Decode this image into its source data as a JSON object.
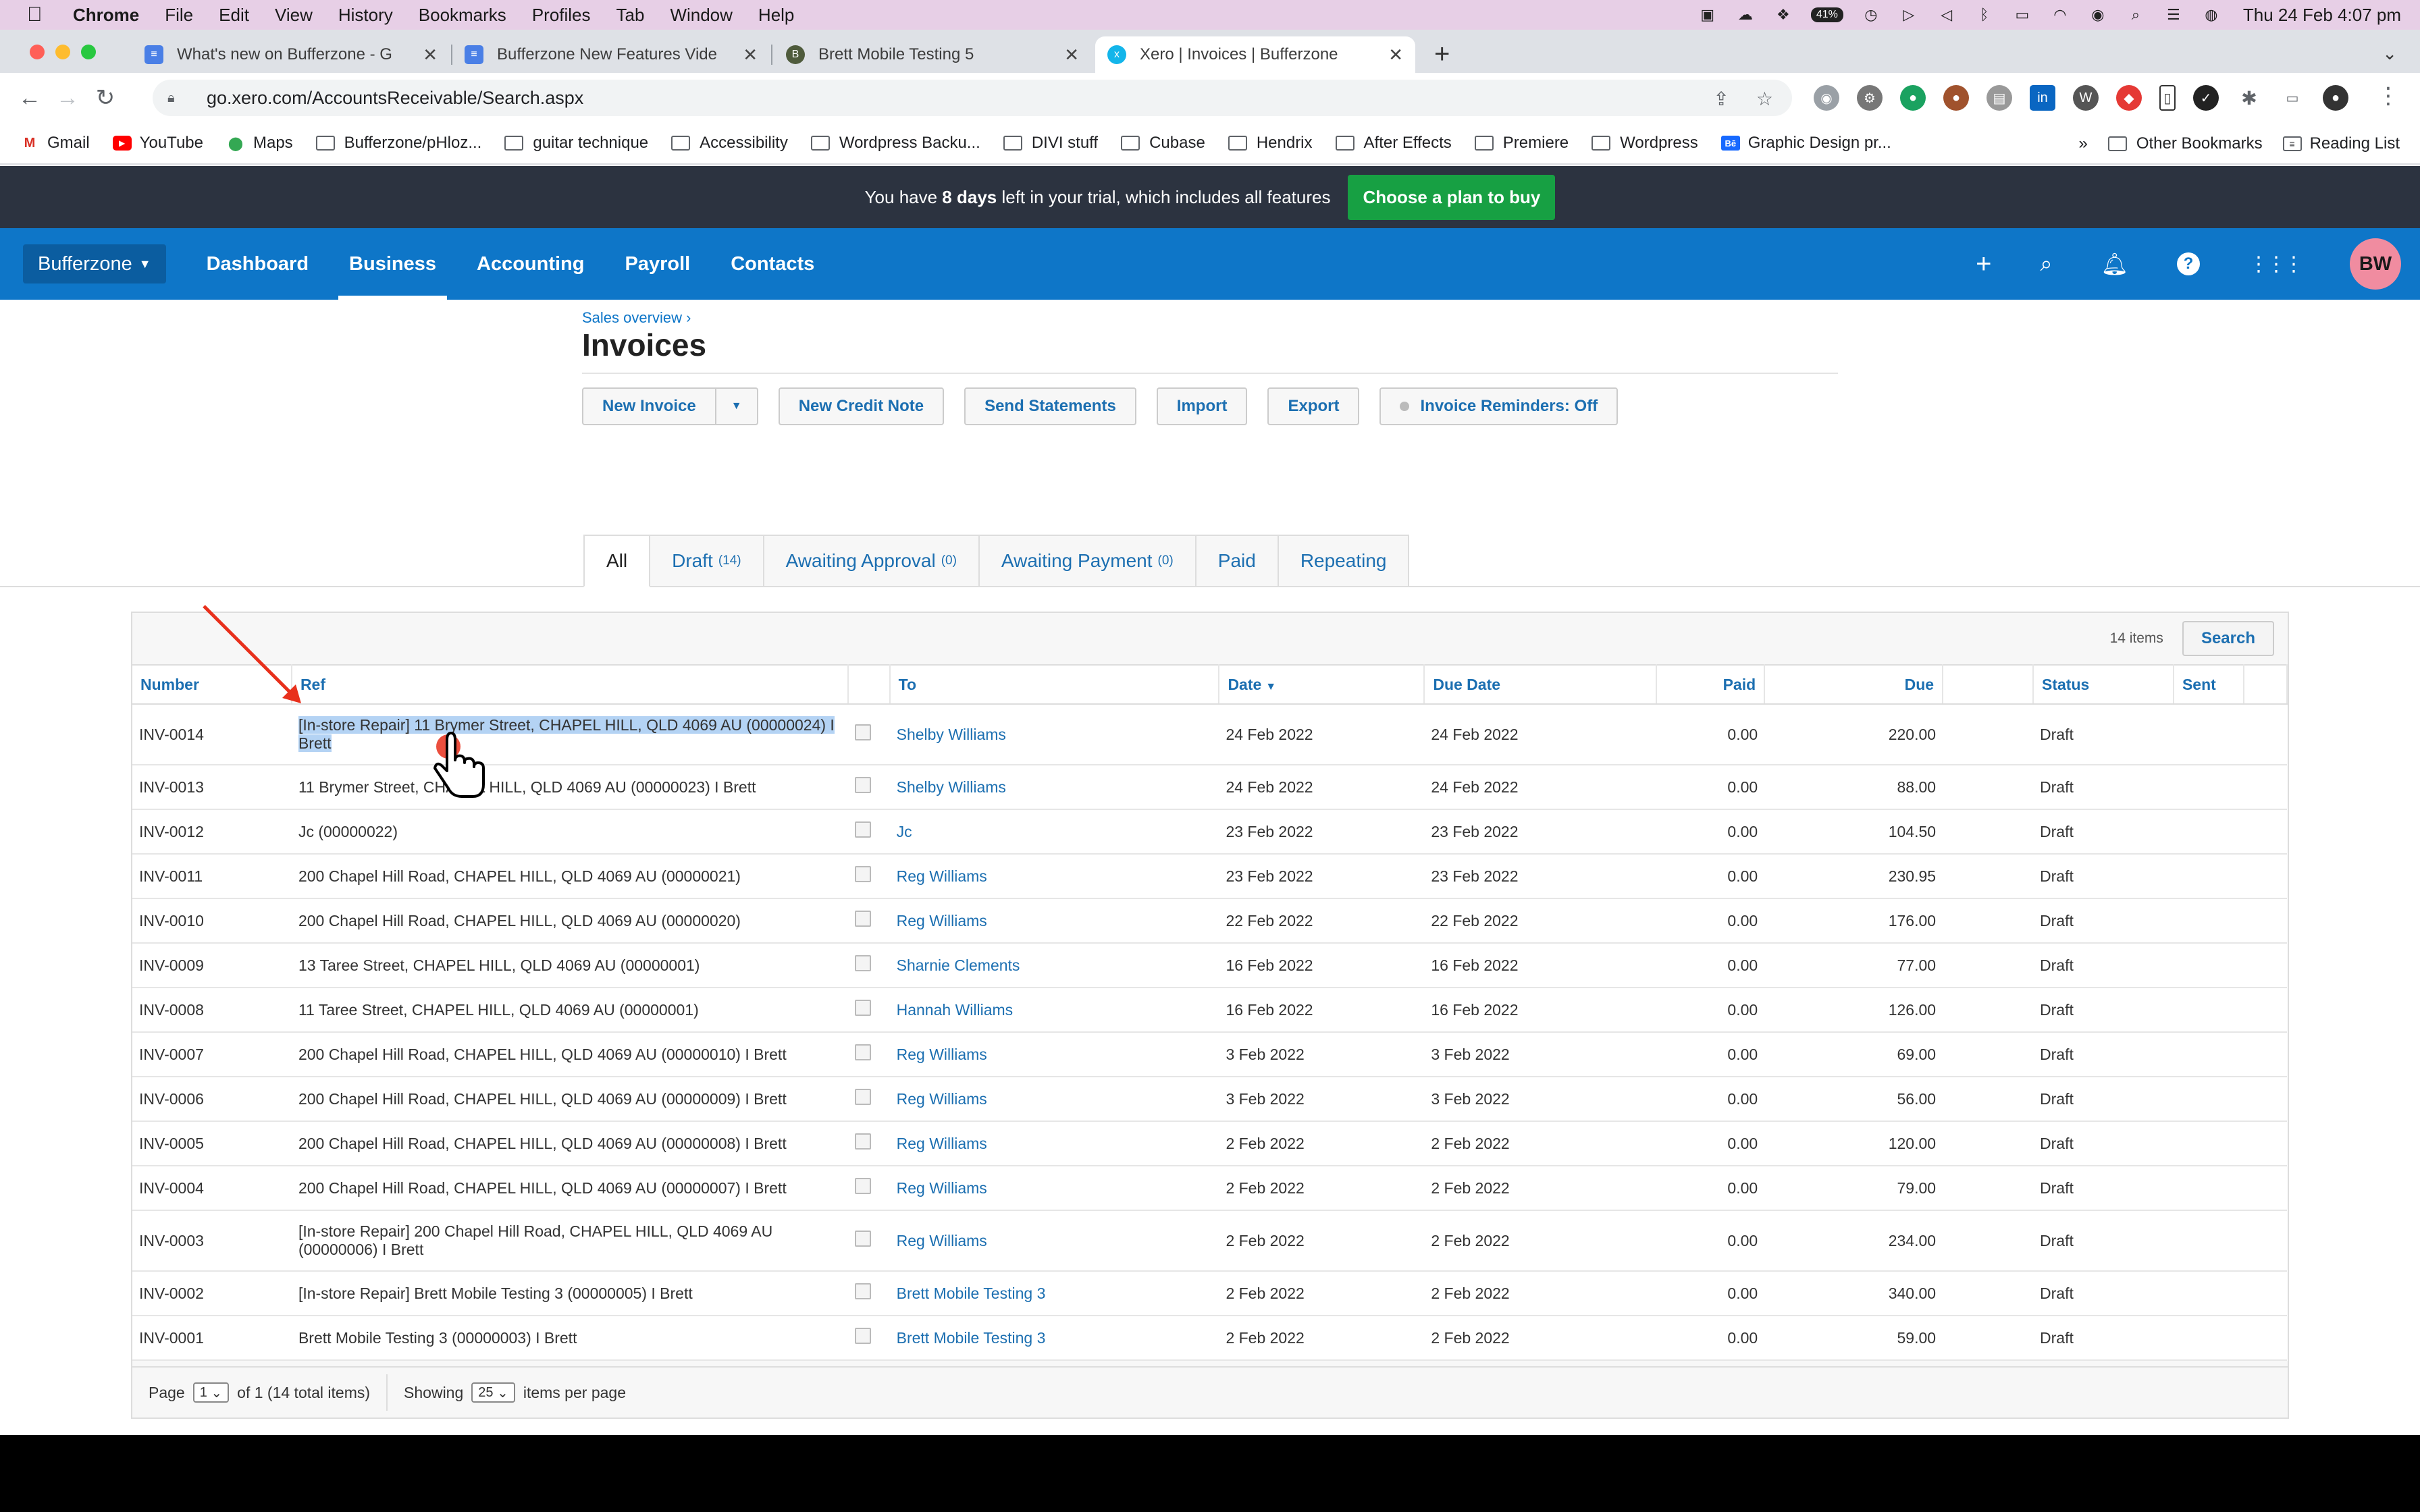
{
  "menubar": {
    "items": [
      "Chrome",
      "File",
      "Edit",
      "View",
      "History",
      "Bookmarks",
      "Profiles",
      "Tab",
      "Window",
      "Help"
    ],
    "battery_text": "41%",
    "clock": "Thu 24 Feb  4:07 pm"
  },
  "tabs": [
    {
      "title": "What's new on Bufferzone - G",
      "favicon_color": "#4a7fe6",
      "favicon": "doc-icon"
    },
    {
      "title": "Bufferzone New Features Vide",
      "favicon_color": "#4a7fe6",
      "favicon": "doc-icon"
    },
    {
      "title": "Brett Mobile Testing 5",
      "favicon_color": "#4f5b3c",
      "favicon": "b-icon"
    },
    {
      "title": "Xero | Invoices | Bufferzone",
      "favicon_color": "#13b5ea",
      "favicon": "xero-icon"
    }
  ],
  "omnibox": {
    "url": "go.xero.com/AccountsReceivable/Search.aspx"
  },
  "bookmarks": [
    {
      "label": "Gmail",
      "type": "gmail"
    },
    {
      "label": "YouTube",
      "type": "youtube"
    },
    {
      "label": "Maps",
      "type": "maps"
    },
    {
      "label": "Bufferzone/pHloz...",
      "type": "folder"
    },
    {
      "label": "guitar technique",
      "type": "folder"
    },
    {
      "label": "Accessibility",
      "type": "folder"
    },
    {
      "label": "Wordpress Backu...",
      "type": "folder"
    },
    {
      "label": "DIVI stuff",
      "type": "folder"
    },
    {
      "label": "Cubase",
      "type": "folder"
    },
    {
      "label": "Hendrix",
      "type": "folder"
    },
    {
      "label": "After Effects",
      "type": "folder"
    },
    {
      "label": "Premiere",
      "type": "folder"
    },
    {
      "label": "Wordpress",
      "type": "folder"
    },
    {
      "label": "Graphic Design pr...",
      "type": "behance"
    }
  ],
  "bookmarks_more": "»",
  "bookmarks_other": "Other Bookmarks",
  "bookmarks_reading": "Reading List",
  "trial": {
    "prefix": "You have ",
    "days": "8 days",
    "suffix": " left in your trial, which includes all features",
    "button": "Choose a plan to buy"
  },
  "xero_nav": {
    "org": "Bufferzone",
    "items": [
      "Dashboard",
      "Business",
      "Accounting",
      "Payroll",
      "Contacts"
    ],
    "active": "Business",
    "avatar": "BW"
  },
  "page": {
    "breadcrumb": "Sales overview ›",
    "title": "Invoices"
  },
  "actions": {
    "new_invoice": "New Invoice",
    "new_credit_note": "New Credit Note",
    "send_statements": "Send Statements",
    "import": "Import",
    "export": "Export",
    "reminders": "Invoice Reminders: Off"
  },
  "filter_tabs": [
    {
      "label": "All",
      "count": ""
    },
    {
      "label": "Draft",
      "count": "(14)"
    },
    {
      "label": "Awaiting Approval",
      "count": "(0)"
    },
    {
      "label": "Awaiting Payment",
      "count": "(0)"
    },
    {
      "label": "Paid",
      "count": ""
    },
    {
      "label": "Repeating",
      "count": ""
    }
  ],
  "grid": {
    "items_count": "14 items",
    "search_label": "Search",
    "columns": {
      "number": "Number",
      "ref": "Ref",
      "to": "To",
      "date": "Date",
      "due_date": "Due Date",
      "paid": "Paid",
      "due": "Due",
      "status": "Status",
      "sent": "Sent"
    },
    "rows": [
      {
        "number": "INV-0014",
        "ref": "[In-store Repair] 11 Brymer Street, CHAPEL HILL, QLD 4069 AU (00000024) I Brett",
        "to": "Shelby Williams",
        "date": "24 Feb 2022",
        "due_date": "24 Feb 2022",
        "paid": "0.00",
        "due": "220.00",
        "status": "Draft"
      },
      {
        "number": "INV-0013",
        "ref": "11 Brymer Street, CHAPEL HILL, QLD 4069 AU (00000023) I Brett",
        "to": "Shelby Williams",
        "date": "24 Feb 2022",
        "due_date": "24 Feb 2022",
        "paid": "0.00",
        "due": "88.00",
        "status": "Draft"
      },
      {
        "number": "INV-0012",
        "ref": "Jc (00000022)",
        "to": "Jc",
        "date": "23 Feb 2022",
        "due_date": "23 Feb 2022",
        "paid": "0.00",
        "due": "104.50",
        "status": "Draft"
      },
      {
        "number": "INV-0011",
        "ref": "200 Chapel Hill Road, CHAPEL HILL, QLD 4069 AU (00000021)",
        "to": "Reg Williams",
        "date": "23 Feb 2022",
        "due_date": "23 Feb 2022",
        "paid": "0.00",
        "due": "230.95",
        "status": "Draft"
      },
      {
        "number": "INV-0010",
        "ref": "200 Chapel Hill Road, CHAPEL HILL, QLD 4069 AU (00000020)",
        "to": "Reg Williams",
        "date": "22 Feb 2022",
        "due_date": "22 Feb 2022",
        "paid": "0.00",
        "due": "176.00",
        "status": "Draft"
      },
      {
        "number": "INV-0009",
        "ref": "13 Taree Street, CHAPEL HILL, QLD 4069 AU (00000001)",
        "to": "Sharnie Clements",
        "date": "16 Feb 2022",
        "due_date": "16 Feb 2022",
        "paid": "0.00",
        "due": "77.00",
        "status": "Draft"
      },
      {
        "number": "INV-0008",
        "ref": "11 Taree Street, CHAPEL HILL, QLD 4069 AU (00000001)",
        "to": "Hannah Williams",
        "date": "16 Feb 2022",
        "due_date": "16 Feb 2022",
        "paid": "0.00",
        "due": "126.00",
        "status": "Draft"
      },
      {
        "number": "INV-0007",
        "ref": "200 Chapel Hill Road, CHAPEL HILL, QLD 4069 AU (00000010) I Brett",
        "to": "Reg Williams",
        "date": "3 Feb 2022",
        "due_date": "3 Feb 2022",
        "paid": "0.00",
        "due": "69.00",
        "status": "Draft"
      },
      {
        "number": "INV-0006",
        "ref": "200 Chapel Hill Road, CHAPEL HILL, QLD 4069 AU (00000009) I Brett",
        "to": "Reg Williams",
        "date": "3 Feb 2022",
        "due_date": "3 Feb 2022",
        "paid": "0.00",
        "due": "56.00",
        "status": "Draft"
      },
      {
        "number": "INV-0005",
        "ref": "200 Chapel Hill Road, CHAPEL HILL, QLD 4069 AU (00000008) I Brett",
        "to": "Reg Williams",
        "date": "2 Feb 2022",
        "due_date": "2 Feb 2022",
        "paid": "0.00",
        "due": "120.00",
        "status": "Draft"
      },
      {
        "number": "INV-0004",
        "ref": "200 Chapel Hill Road, CHAPEL HILL, QLD 4069 AU (00000007) I Brett",
        "to": "Reg Williams",
        "date": "2 Feb 2022",
        "due_date": "2 Feb 2022",
        "paid": "0.00",
        "due": "79.00",
        "status": "Draft"
      },
      {
        "number": "INV-0003",
        "ref": "[In-store Repair] 200 Chapel Hill Road, CHAPEL HILL, QLD 4069 AU (00000006) I Brett",
        "to": "Reg Williams",
        "date": "2 Feb 2022",
        "due_date": "2 Feb 2022",
        "paid": "0.00",
        "due": "234.00",
        "status": "Draft"
      },
      {
        "number": "INV-0002",
        "ref": "[In-store Repair] Brett Mobile Testing 3 (00000005) I Brett",
        "to": "Brett Mobile Testing 3",
        "date": "2 Feb 2022",
        "due_date": "2 Feb 2022",
        "paid": "0.00",
        "due": "340.00",
        "status": "Draft"
      },
      {
        "number": "INV-0001",
        "ref": "Brett Mobile Testing 3 (00000003) I Brett",
        "to": "Brett Mobile Testing 3",
        "date": "2 Feb 2022",
        "due_date": "2 Feb 2022",
        "paid": "0.00",
        "due": "59.00",
        "status": "Draft"
      }
    ],
    "selected_row": 0
  },
  "footer": {
    "page_label": "Page",
    "page_value": "1",
    "of_text": "of 1 (14 total items)",
    "showing_label": "Showing",
    "per_page_value": "25",
    "per_page_suffix": "items per page"
  },
  "colors": {
    "xero_blue": "#0e76c8",
    "trial_bg": "#2c3340",
    "buy_green": "#17a043",
    "annotation_red": "#e8301c",
    "selection": "#b4d3f4"
  }
}
